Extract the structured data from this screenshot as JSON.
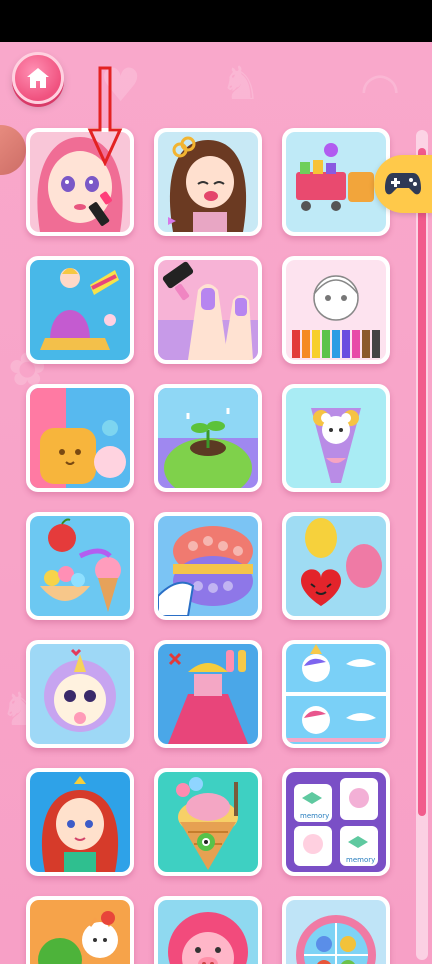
{
  "header": {
    "home_icon": "home-icon"
  },
  "overlay": {
    "annotation_arrow": "down-arrow",
    "gamepad_icon": "gamepad-icon"
  },
  "games": [
    {
      "name": "makeup-game",
      "icon": "princess-makeup-icon"
    },
    {
      "name": "hair-salon-game",
      "icon": "hair-cut-icon"
    },
    {
      "name": "shopping-game",
      "icon": "shopping-cart-icon"
    },
    {
      "name": "princess-cake-game",
      "icon": "doll-cake-icon"
    },
    {
      "name": "nail-salon-game",
      "icon": "nail-polish-icon"
    },
    {
      "name": "coloring-game",
      "icon": "coloring-page-icon"
    },
    {
      "name": "drinks-game",
      "icon": "juice-icon"
    },
    {
      "name": "plant-growing-game",
      "icon": "sprout-icon"
    },
    {
      "name": "bouquet-game",
      "icon": "bear-bouquet-icon"
    },
    {
      "name": "ice-cream-game",
      "icon": "ice-cream-icon"
    },
    {
      "name": "pop-it-game",
      "icon": "pop-it-icon"
    },
    {
      "name": "balloon-game",
      "icon": "balloon-icon"
    },
    {
      "name": "pet-dressup-game",
      "icon": "unicorn-pet-icon"
    },
    {
      "name": "dress-design-game",
      "icon": "dress-icon"
    },
    {
      "name": "unicorn-puzzle-game",
      "icon": "unicorn-icon"
    },
    {
      "name": "mermaid-game",
      "icon": "mermaid-icon"
    },
    {
      "name": "ice-cream-cone-game",
      "icon": "cone-icon"
    },
    {
      "name": "memory-game",
      "icon": "memory-cards-icon"
    },
    {
      "name": "fruit-game",
      "icon": "fruit-icon"
    },
    {
      "name": "pig-game",
      "icon": "pig-icon"
    },
    {
      "name": "fish-game",
      "icon": "fish-icon"
    }
  ],
  "memory_card_label": "memory",
  "colors": {
    "background": "#f7a6c9",
    "accent": "#f15b8c",
    "gamepad": "#ffc94a"
  }
}
